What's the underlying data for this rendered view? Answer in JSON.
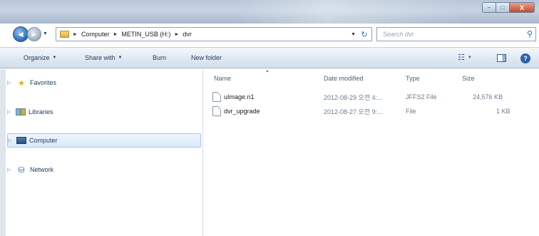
{
  "window": {
    "controls": {
      "minimize": "–",
      "maximize": "□",
      "close": "X"
    }
  },
  "address_bar": {
    "breadcrumbs": [
      "Computer",
      "METIN_USB (H:)",
      "dvr"
    ],
    "refresh_icon": "refresh-icon"
  },
  "search": {
    "placeholder": "Search dvr"
  },
  "toolbar": {
    "organize_label": "Organize",
    "share_label": "Share with",
    "burn_label": "Burn",
    "new_folder_label": "New folder"
  },
  "nav_pane": {
    "items": [
      {
        "label": "Favorites",
        "icon": "star-icon"
      },
      {
        "label": "Libraries",
        "icon": "library-icon"
      },
      {
        "label": "Computer",
        "icon": "computer-icon",
        "selected": true
      },
      {
        "label": "Network",
        "icon": "network-icon"
      }
    ]
  },
  "file_list": {
    "columns": [
      "Name",
      "Date modified",
      "Type",
      "Size"
    ],
    "rows": [
      {
        "name": "uImage.n1",
        "date": "2012-08-29 오전 4:...",
        "type": "JFFS2 File",
        "size": "24,576 KB"
      },
      {
        "name": "dvr_upgrade",
        "date": "2012-08-27 오전 9:...",
        "type": "File",
        "size": "1 KB"
      }
    ]
  },
  "colors": {
    "accent": "#2c62a8",
    "selection_bg": "#dbeafa",
    "titlebar": "#b7c6d8",
    "close_button": "#c44a2c"
  }
}
